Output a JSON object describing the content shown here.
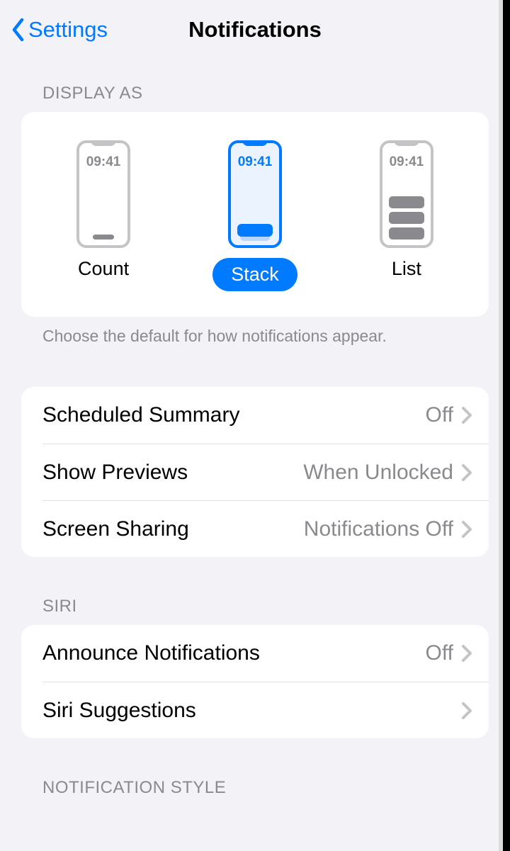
{
  "header": {
    "back_label": "Settings",
    "title": "Notifications"
  },
  "display": {
    "section_header": "DISPLAY AS",
    "phone_time": "09:41",
    "options": [
      {
        "label": "Count",
        "selected": false
      },
      {
        "label": "Stack",
        "selected": true
      },
      {
        "label": "List",
        "selected": false
      }
    ],
    "footer": "Choose the default for how notifications appear."
  },
  "general_rows": [
    {
      "label": "Scheduled Summary",
      "value": "Off"
    },
    {
      "label": "Show Previews",
      "value": "When Unlocked"
    },
    {
      "label": "Screen Sharing",
      "value": "Notifications Off"
    }
  ],
  "siri": {
    "section_header": "SIRI",
    "rows": [
      {
        "label": "Announce Notifications",
        "value": "Off"
      },
      {
        "label": "Siri Suggestions",
        "value": ""
      }
    ]
  },
  "notification_style": {
    "section_header": "NOTIFICATION STYLE"
  }
}
